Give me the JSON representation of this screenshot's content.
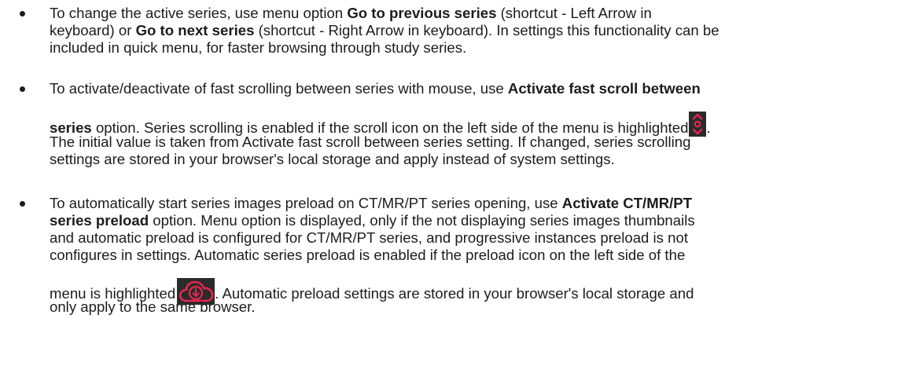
{
  "bullets": [
    {
      "l1": {
        "a": "To change the active series, use menu option ",
        "b": "Go to previous series",
        "c": " (shortcut - Left Arrow in"
      },
      "l2": {
        "a": "keyboard) or ",
        "b": "Go to next series",
        "c": " (shortcut - Right Arrow in keyboard). In settings this functionality can be"
      },
      "l3": "included in quick menu, for faster browsing through study series."
    },
    {
      "l1": {
        "a": "To activate/deactivate of fast scrolling between series with mouse, use ",
        "b": "Activate fast scroll between"
      },
      "l2": {
        "b": "series",
        "a": " option. Series scrolling is enabled if the scroll icon on the left side of the menu is highlighted",
        "c": "."
      },
      "l3": "The initial value is taken from Activate fast scroll between series setting. If changed, series scrolling",
      "l4": "settings are stored in your browser's local storage and apply instead of system settings."
    },
    {
      "l1": {
        "a": "To automatically start series images preload on CT/MR/PT series opening, use ",
        "b": "Activate CT/MR/PT"
      },
      "l2": {
        "b": "series preload",
        "a": " option. Menu option is displayed, only if the not displaying series images thumbnails"
      },
      "l3": "and automatic preload is configured for CT/MR/PT series, and progressive instances preload is not",
      "l4": "configures in settings. Automatic series preload is enabled if the preload icon on the left side of the",
      "l5": {
        "a": "menu is highlighted",
        "c": ". Automatic preload settings are stored in your browser's local storage and"
      },
      "l6": "only apply to the same browser."
    }
  ],
  "icons": {
    "scroll": "scroll-arrows-icon",
    "preload": "cloud-download-icon",
    "accent_color": "#e8254f",
    "icon_bg": "#2b2b2b"
  }
}
